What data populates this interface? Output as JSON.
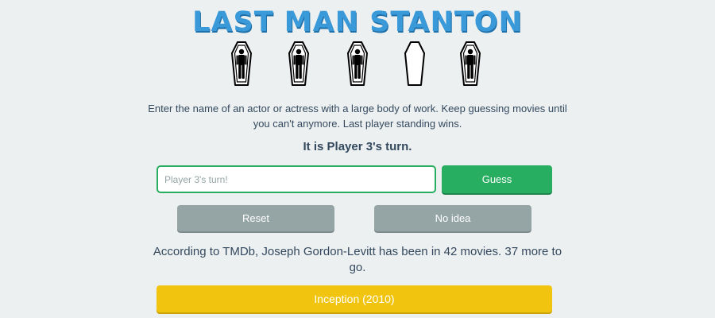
{
  "game": {
    "title": "LAST MAN STANTON",
    "description": "Enter the name of an actor or actress with a large body of work. Keep guessing movies until you can't anymore. Last player standing wins.",
    "turn_text": "It is Player 3's turn.",
    "players": [
      {
        "status": "alive",
        "icon": "coffin-with-person-icon"
      },
      {
        "status": "alive",
        "icon": "coffin-with-person-icon"
      },
      {
        "status": "alive",
        "icon": "coffin-with-person-icon"
      },
      {
        "status": "empty",
        "icon": "empty-coffin-icon"
      },
      {
        "status": "alive",
        "icon": "coffin-with-person-icon"
      }
    ]
  },
  "guess": {
    "placeholder": "Player 3's turn!",
    "value": "",
    "button_label": "Guess"
  },
  "controls": {
    "reset_label": "Reset",
    "no_idea_label": "No idea"
  },
  "info": {
    "text": "According to TMDb, Joseph Gordon-Levitt has been in 42 movies. 37 more to go."
  },
  "guessed_movies": [
    "Inception (2010)"
  ],
  "colors": {
    "background": "#ecf0f1",
    "title": "#3a9ad9",
    "guess_button": "#27ae60",
    "gray_button": "#95a5a6",
    "movie_bar": "#f1c40f",
    "text": "#34495e"
  }
}
